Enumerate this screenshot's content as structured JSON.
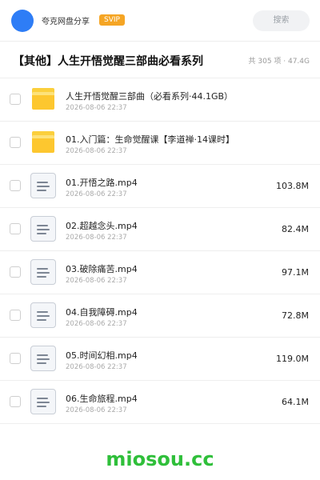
{
  "header": {
    "brand": "夸克网盘分享",
    "badge": "SVIP",
    "search_placeholder": "搜索",
    "avatar_color": "#2e7df6",
    "badge_color": "#f5a524"
  },
  "share": {
    "title": "【其他】人生开悟觉醒三部曲必看系列",
    "meta": "共 305 项 · 47.4G"
  },
  "files": [
    {
      "type": "folder",
      "name": "人生开悟觉醒三部曲（必看系列·44.1GB）",
      "date": "2026-08-06 22:37",
      "size": ""
    },
    {
      "type": "folder",
      "name": "01.入门篇：生命觉醒课【李道禅·14课时】",
      "date": "2026-08-06 22:37",
      "size": ""
    },
    {
      "type": "file",
      "name": "01.开悟之路.mp4",
      "date": "2026-08-06 22:37",
      "size": "103.8M"
    },
    {
      "type": "file",
      "name": "02.超越念头.mp4",
      "date": "2026-08-06 22:37",
      "size": "82.4M"
    },
    {
      "type": "file",
      "name": "03.破除痛苦.mp4",
      "date": "2026-08-06 22:37",
      "size": "97.1M"
    },
    {
      "type": "file",
      "name": "04.自我障碍.mp4",
      "date": "2026-08-06 22:37",
      "size": "72.8M"
    },
    {
      "type": "file",
      "name": "05.时间幻相.mp4",
      "date": "2026-08-06 22:37",
      "size": "119.0M"
    },
    {
      "type": "file",
      "name": "06.生命旅程.mp4",
      "date": "2026-08-06 22:37",
      "size": "64.1M"
    }
  ],
  "watermark": "miosou.cc",
  "colors": {
    "folder": "#fdc72f",
    "watermark": "#2fbf3a"
  }
}
